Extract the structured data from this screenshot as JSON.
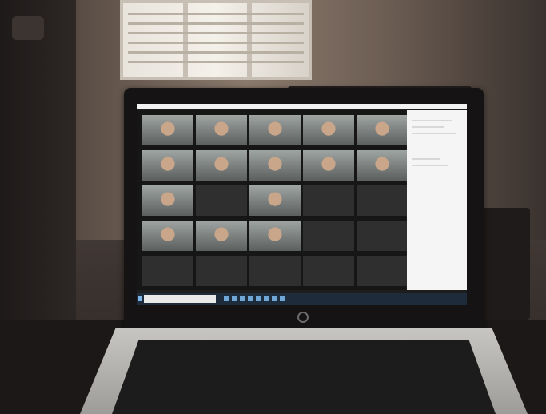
{
  "scene": {
    "description_kind": "photo of laptop showing video call",
    "colors": {
      "wall": "#8a7a6d",
      "screen_bg": "#1d1d1d",
      "taskbar": "#1e2b3a",
      "side_panel": "#f5f5f5"
    }
  },
  "video_call": {
    "tiles": [
      {
        "type": "video",
        "label": ""
      },
      {
        "type": "video",
        "label": ""
      },
      {
        "type": "video",
        "label": ""
      },
      {
        "type": "video",
        "label": ""
      },
      {
        "type": "video",
        "label": ""
      },
      {
        "type": "video",
        "label": ""
      },
      {
        "type": "video",
        "label": ""
      },
      {
        "type": "video",
        "label": ""
      },
      {
        "type": "video",
        "label": ""
      },
      {
        "type": "video",
        "label": ""
      },
      {
        "type": "video",
        "label": ""
      },
      {
        "type": "name",
        "label": ""
      },
      {
        "type": "video",
        "label": ""
      },
      {
        "type": "name",
        "label": ""
      },
      {
        "type": "name",
        "label": ""
      },
      {
        "type": "video",
        "label": ""
      },
      {
        "type": "video",
        "label": ""
      },
      {
        "type": "video",
        "label": ""
      },
      {
        "type": "name",
        "label": ""
      },
      {
        "type": "name",
        "label": ""
      },
      {
        "type": "name",
        "label": ""
      },
      {
        "type": "name",
        "label": ""
      },
      {
        "type": "name",
        "label": ""
      },
      {
        "type": "name",
        "label": ""
      },
      {
        "type": "name",
        "label": ""
      }
    ]
  },
  "taskbar": {
    "icons": [
      "search-icon",
      "task-view-icon",
      "edge-icon",
      "folder-icon",
      "store-icon",
      "mail-icon",
      "chrome-icon",
      "zoom-icon"
    ],
    "tray_text": ""
  }
}
